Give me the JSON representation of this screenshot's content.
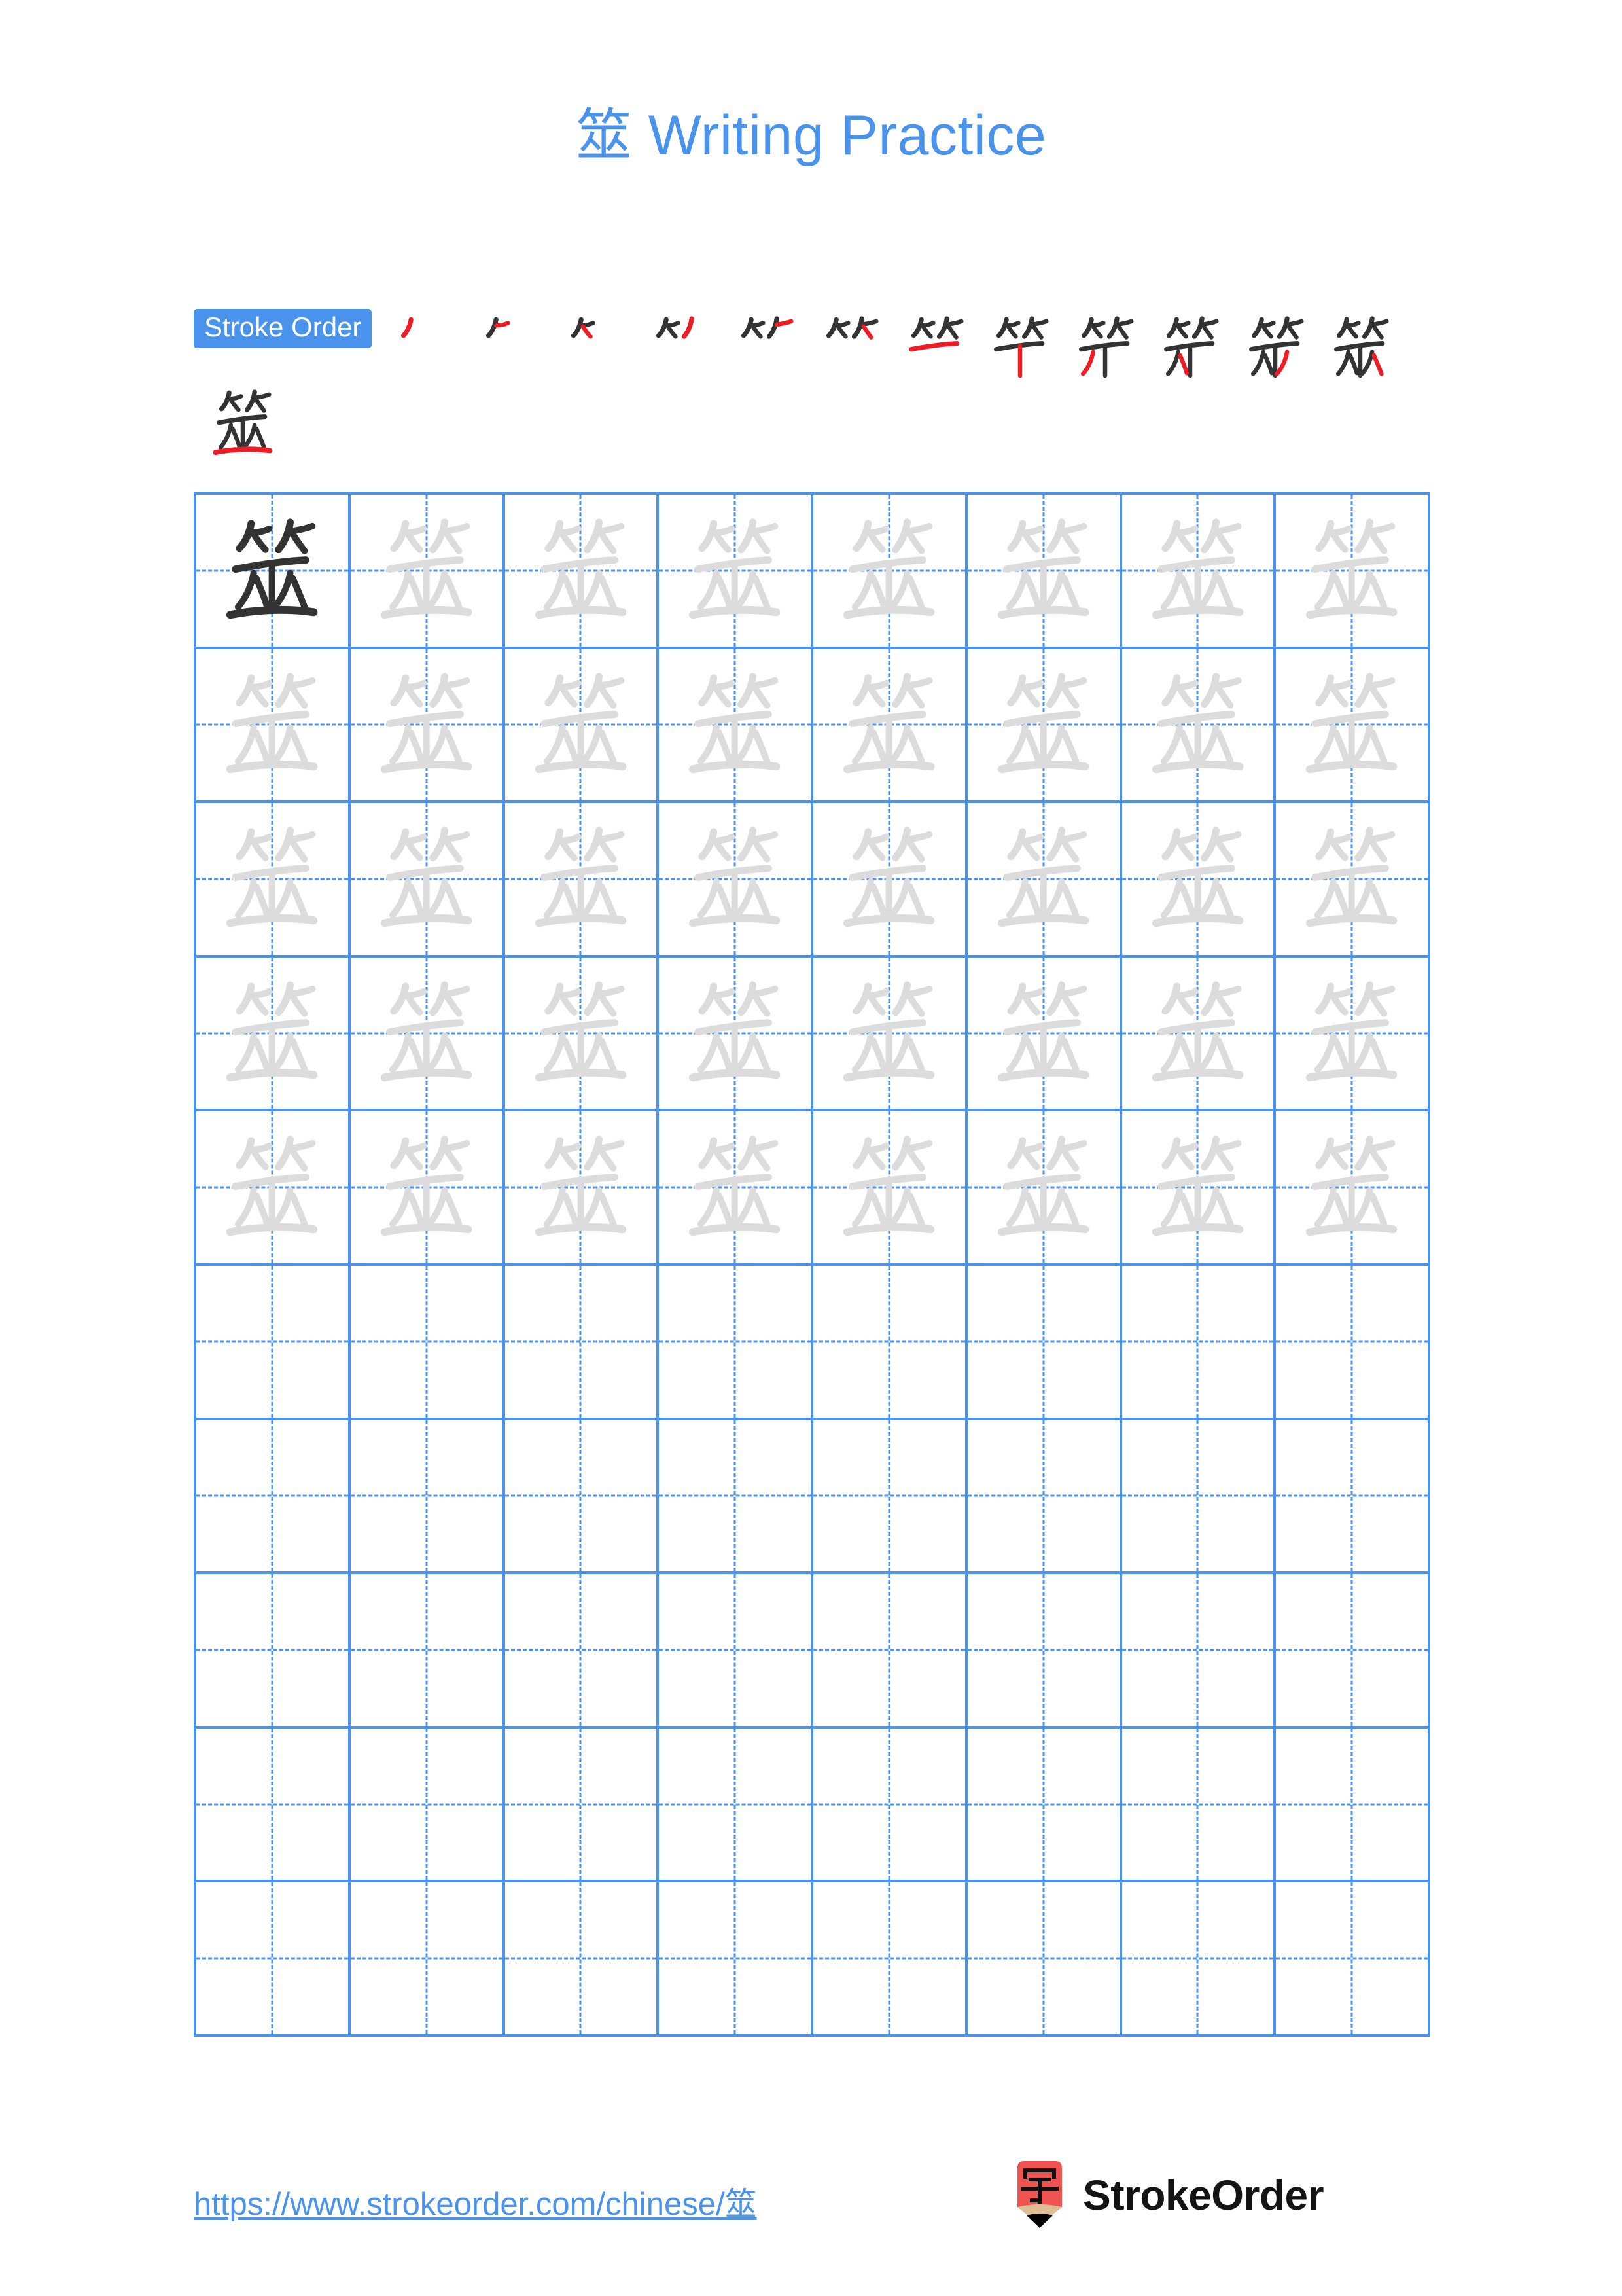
{
  "document": {
    "character": "筮",
    "title_suffix": " Writing Practice",
    "title_full": "筮 Writing Practice",
    "accent_color": "#4a93ec",
    "trace_color": "#dcdcdc",
    "ink_color": "#333333",
    "highlight_stroke_color": "#ee1c25"
  },
  "stroke_order": {
    "badge_label": "Stroke Order",
    "total_strokes": 13,
    "row1_count": 12,
    "row2_count": 1,
    "steps": [
      {
        "index": 1,
        "strokes_shown": 1
      },
      {
        "index": 2,
        "strokes_shown": 2
      },
      {
        "index": 3,
        "strokes_shown": 3
      },
      {
        "index": 4,
        "strokes_shown": 4
      },
      {
        "index": 5,
        "strokes_shown": 5
      },
      {
        "index": 6,
        "strokes_shown": 6
      },
      {
        "index": 7,
        "strokes_shown": 7
      },
      {
        "index": 8,
        "strokes_shown": 8
      },
      {
        "index": 9,
        "strokes_shown": 9
      },
      {
        "index": 10,
        "strokes_shown": 10
      },
      {
        "index": 11,
        "strokes_shown": 11
      },
      {
        "index": 12,
        "strokes_shown": 12
      },
      {
        "index": 13,
        "strokes_shown": 13
      }
    ]
  },
  "practice_grid": {
    "columns": 8,
    "rows": 10,
    "filled_rows": 5,
    "empty_rows": 5,
    "first_cell_style": "dark",
    "trace_cell_style": "light-gray"
  },
  "footer": {
    "url": "https://www.strokeorder.com/chinese/筮",
    "brand_name": "StrokeOrder",
    "logo_character": "字",
    "logo_body_color": "#ef5350",
    "logo_wood_color": "#e0bd95",
    "logo_tip_color": "#000000"
  }
}
